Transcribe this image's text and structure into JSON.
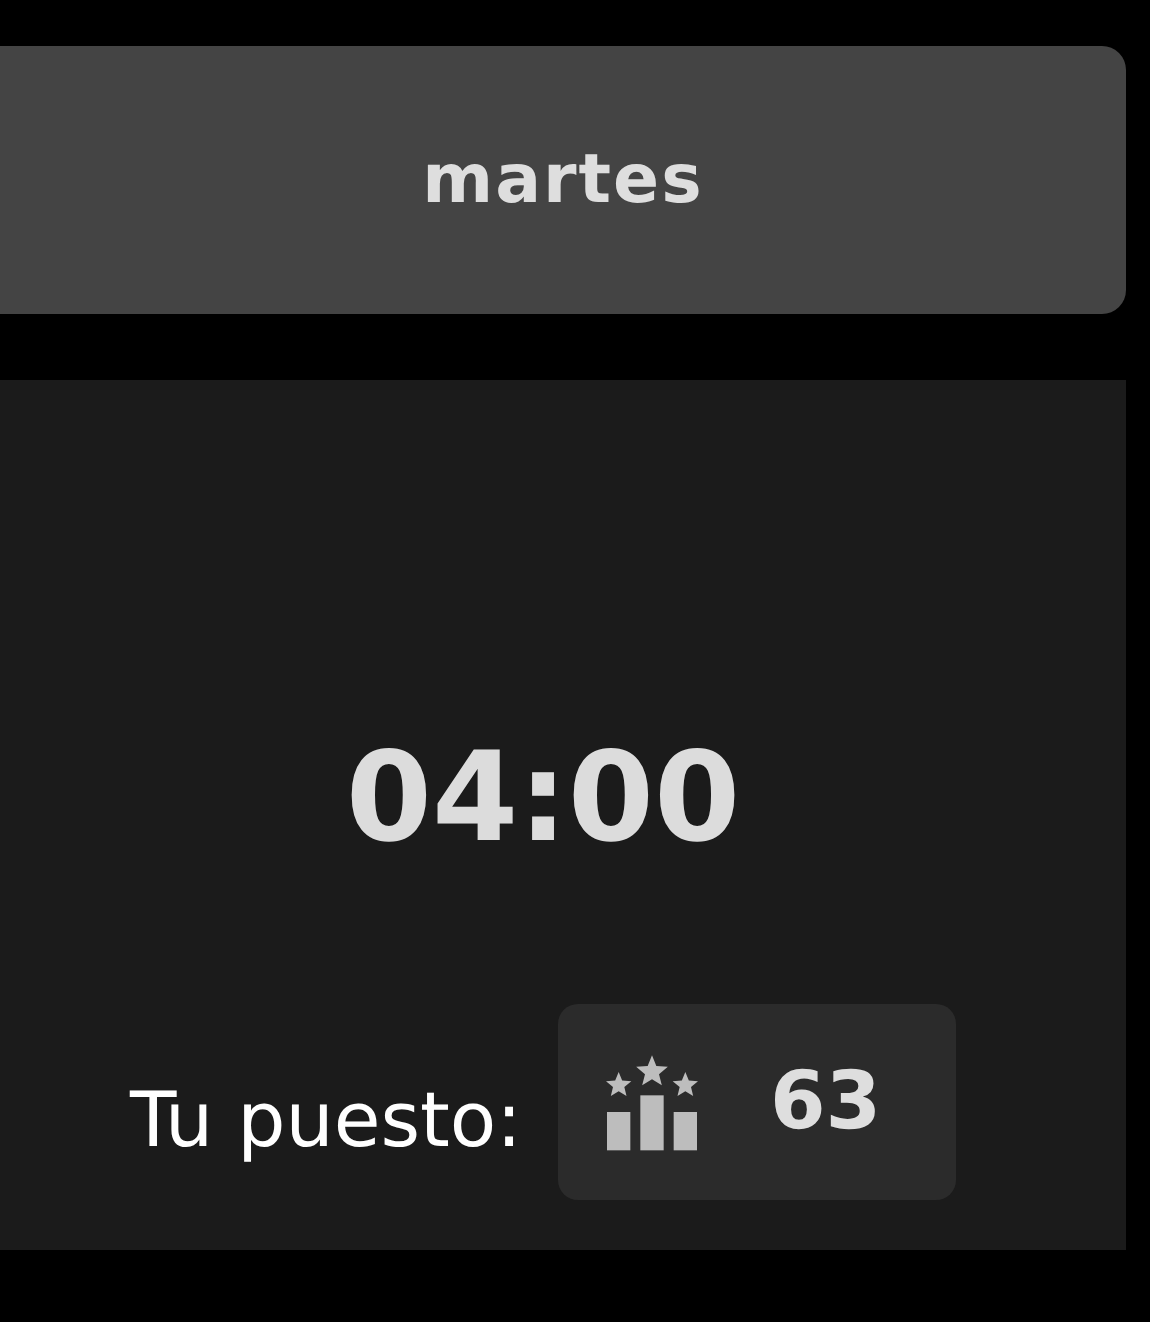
{
  "day_header": {
    "label": "martes"
  },
  "timer": {
    "time": "04:00"
  },
  "rank": {
    "label": "Tu puesto:",
    "value": "63"
  }
}
